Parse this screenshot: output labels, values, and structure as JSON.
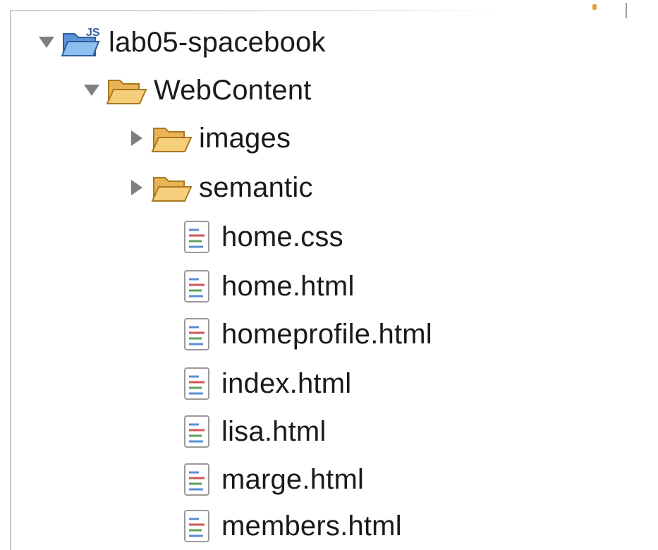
{
  "project": {
    "label": "lab05-spacebook",
    "expanded": true,
    "icon": "project-folder-icon",
    "children": {
      "webcontent": {
        "label": "WebContent",
        "expanded": true,
        "icon": "folder-open-icon",
        "folders": [
          {
            "label": "images",
            "expanded": false,
            "icon": "folder-icon"
          },
          {
            "label": "semantic",
            "expanded": false,
            "icon": "folder-icon"
          }
        ],
        "files": [
          {
            "label": "home.css",
            "icon": "file-icon"
          },
          {
            "label": "home.html",
            "icon": "file-icon"
          },
          {
            "label": "homeprofile.html",
            "icon": "file-icon"
          },
          {
            "label": "index.html",
            "icon": "file-icon"
          },
          {
            "label": "lisa.html",
            "icon": "file-icon"
          },
          {
            "label": "marge.html",
            "icon": "file-icon"
          },
          {
            "label": "members.html",
            "icon": "file-icon"
          }
        ]
      }
    }
  },
  "colors": {
    "folder_fill": "#f3c56a",
    "folder_stroke": "#b8862d",
    "toggle": "#7f7f7f",
    "project_folder_fill": "#7fb0e6"
  }
}
